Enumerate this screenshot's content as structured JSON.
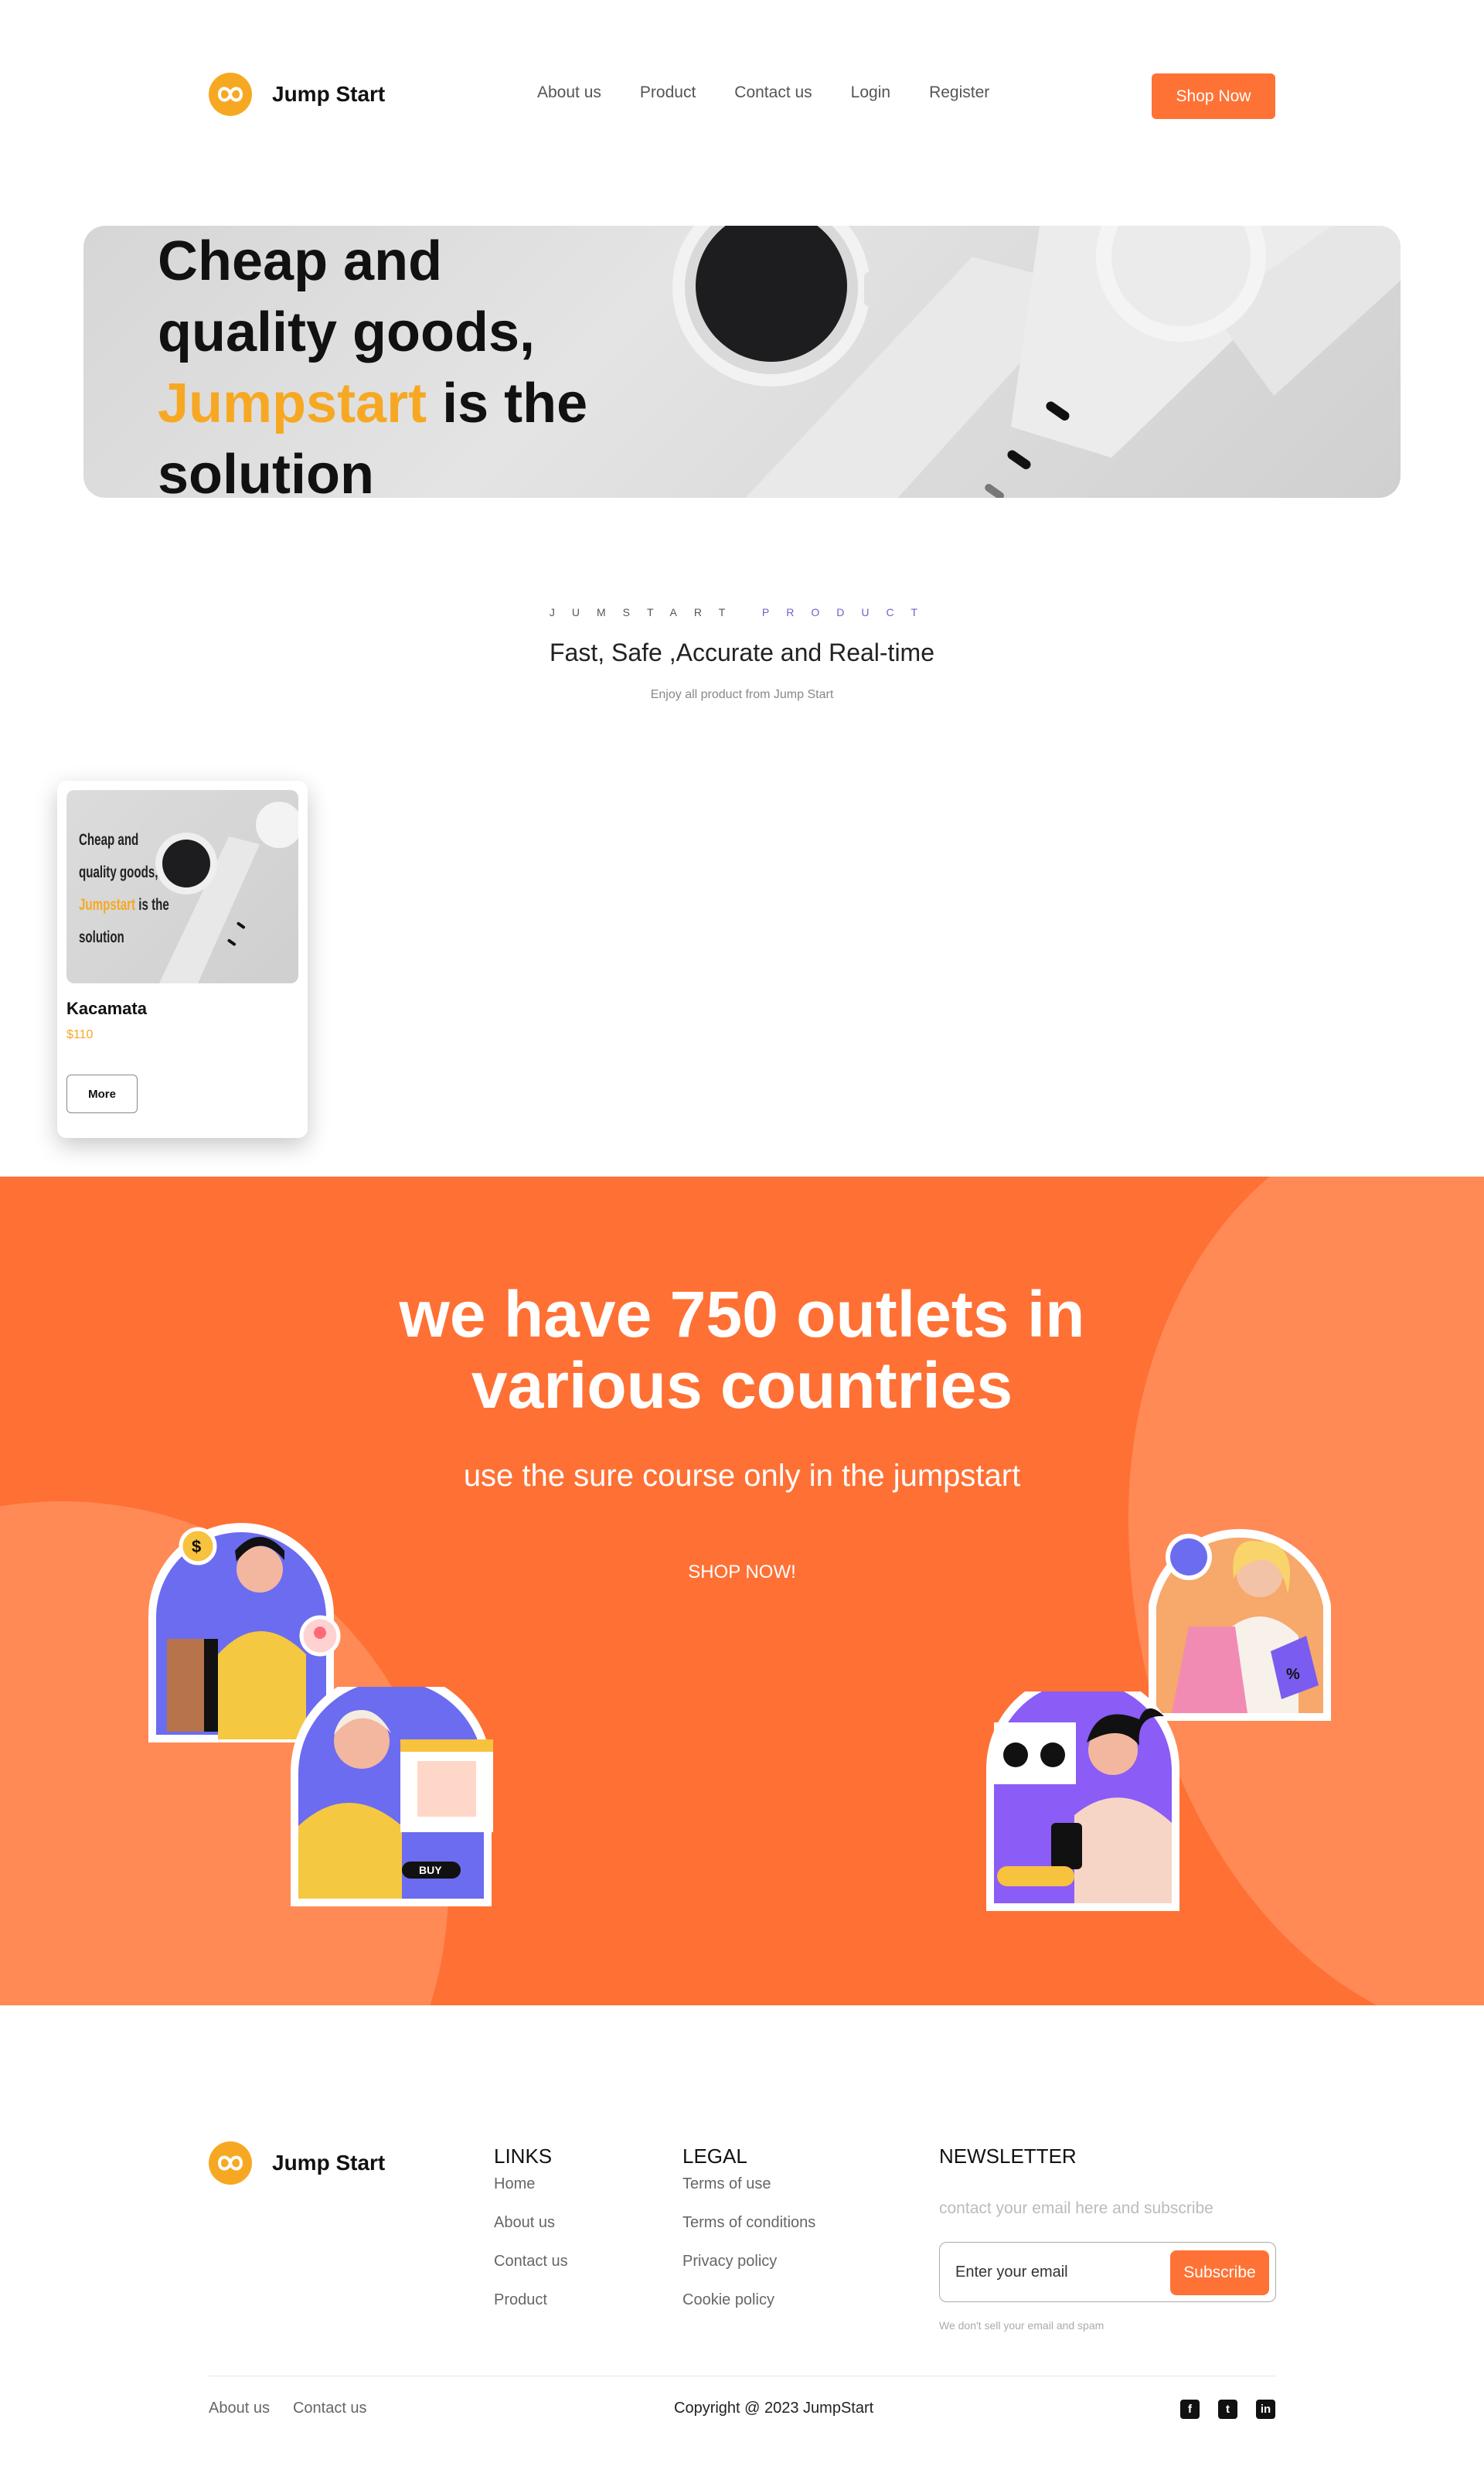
{
  "brand": {
    "name": "Jump Start"
  },
  "nav": {
    "links": [
      "About us",
      "Product",
      "Contact us",
      "Login",
      "Register"
    ],
    "cta": "Shop Now"
  },
  "hero": {
    "line1": "Cheap and",
    "line2": "quality goods,",
    "accent": "Jumpstart",
    "line3_rest": " is the",
    "line4": "solution"
  },
  "products_section": {
    "eyebrow_1": "JUMSTART",
    "eyebrow_2": "PRODUCT",
    "title": "Fast, Safe ,Accurate and Real-time",
    "subtitle": "Enjoy all product from Jump Start"
  },
  "product_card": {
    "image_line1": "Cheap and",
    "image_line2": "quality goods,",
    "image_accent": "Jumpstart",
    "image_line3_rest": " is the",
    "image_line4": "solution",
    "name": "Kacamata",
    "price": "$110",
    "button": "More"
  },
  "banner": {
    "title_line1": "we have 750 outlets in",
    "title_line2": "various countries",
    "subtitle": "use the sure course only in the jumpstart",
    "button": "SHOP NOW!",
    "colors": {
      "main": "#ff7034",
      "accent": "#ff8a55"
    }
  },
  "footer": {
    "links_heading": "LINKS",
    "links": [
      "Home",
      "About us",
      "Contact us",
      "Product"
    ],
    "legal_heading": "LEGAL",
    "legal": [
      "Terms of use",
      "Terms of conditions",
      "Privacy policy",
      "Cookie policy"
    ],
    "newsletter_heading": "NEWSLETTER",
    "newsletter_hint": "contact your email here and subscribe",
    "email_placeholder": "Enter your email",
    "subscribe": "Subscribe",
    "note": "We don't sell your email and spam",
    "bottom_links": [
      "About us",
      "Contact us"
    ],
    "copyright": "Copyright @ 2023 JumpStart",
    "socials": [
      "facebook-icon",
      "twitter-icon",
      "linkedin-icon"
    ]
  },
  "colors": {
    "brand_orange": "#ff7235",
    "brand_yellow": "#f7a823"
  }
}
